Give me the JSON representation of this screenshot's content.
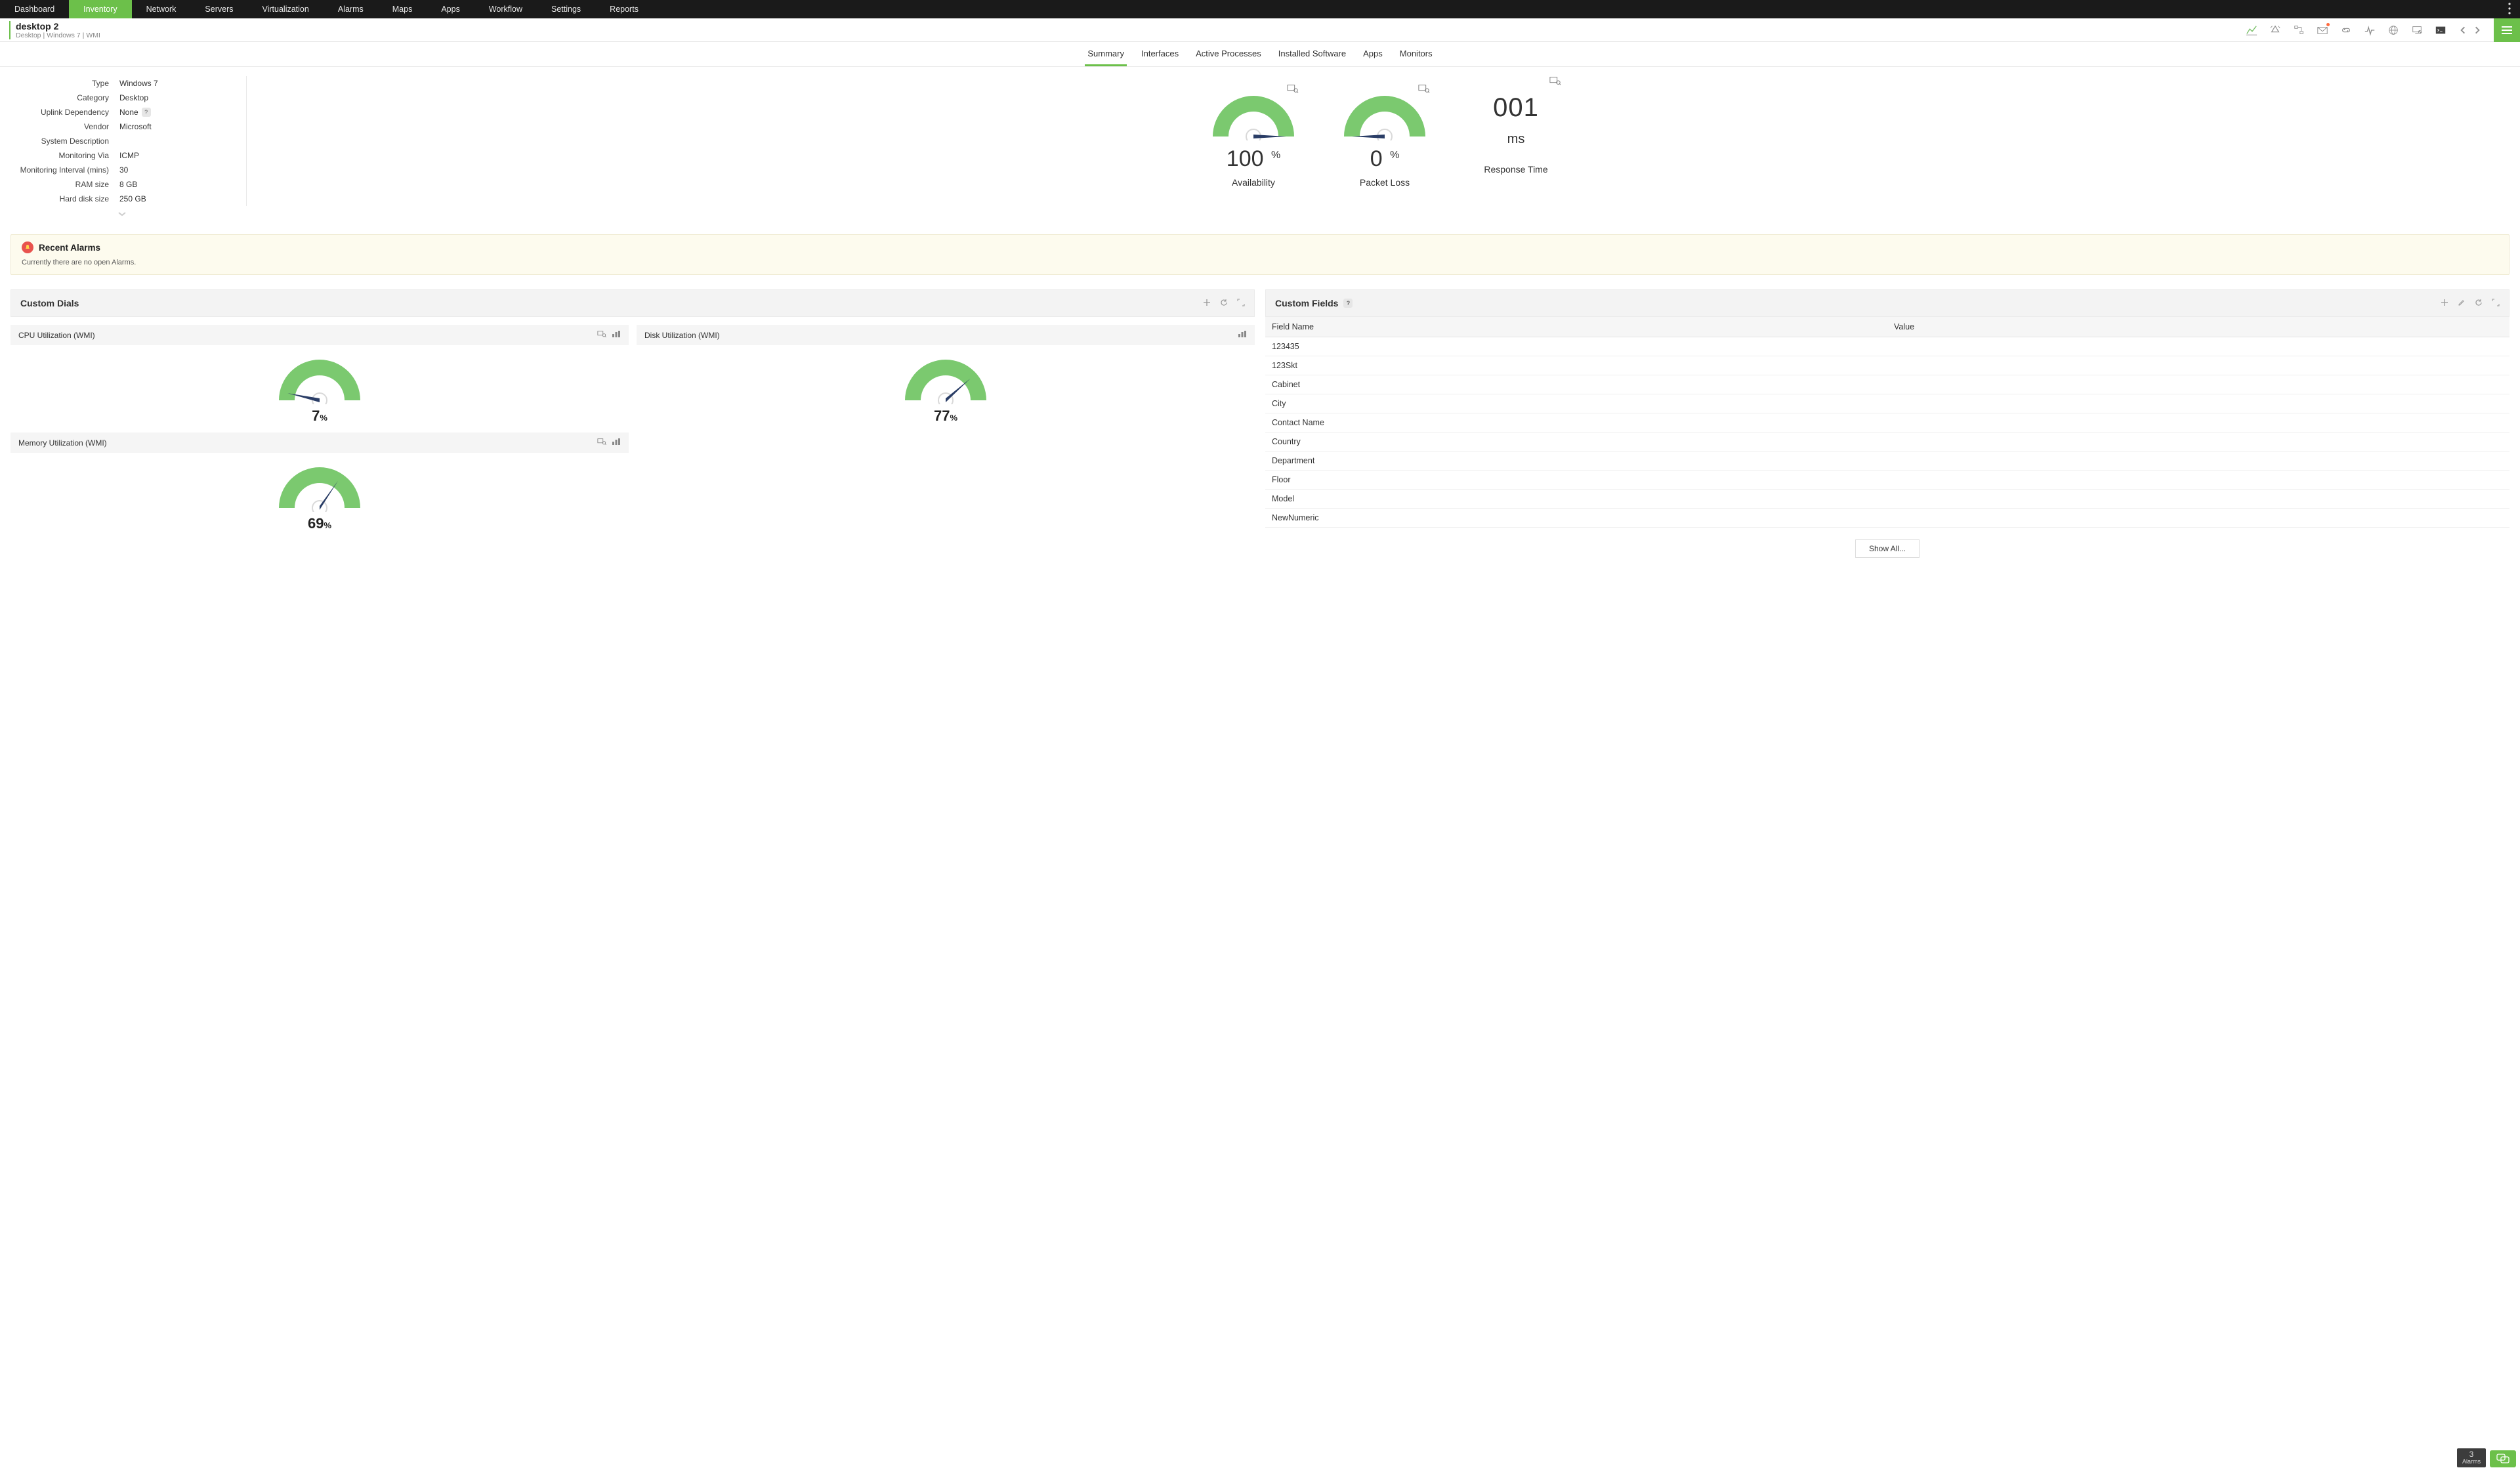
{
  "topnav": {
    "items": [
      "Dashboard",
      "Inventory",
      "Network",
      "Servers",
      "Virtualization",
      "Alarms",
      "Maps",
      "Apps",
      "Workflow",
      "Settings",
      "Reports"
    ],
    "active_index": 1
  },
  "subheader": {
    "title": "desktop 2",
    "crumbs": [
      "Desktop",
      "Windows 7",
      "WMI"
    ]
  },
  "tabs": {
    "items": [
      "Summary",
      "Interfaces",
      "Active Processes",
      "Installed Software",
      "Apps",
      "Monitors"
    ],
    "active_index": 0
  },
  "details": [
    {
      "label": "Type",
      "value": "Windows 7"
    },
    {
      "label": "Category",
      "value": "Desktop"
    },
    {
      "label": "Uplink Dependency",
      "value": "None",
      "help": true
    },
    {
      "label": "Vendor",
      "value": "Microsoft"
    },
    {
      "label": "System Description",
      "value": ""
    },
    {
      "label": "Monitoring Via",
      "value": "ICMP"
    },
    {
      "label": "Monitoring Interval (mins)",
      "value": "30"
    },
    {
      "label": "RAM size",
      "value": "8 GB"
    },
    {
      "label": "Hard disk size",
      "value": "250 GB"
    }
  ],
  "chart_data": {
    "kpi_gauges": [
      {
        "type": "gauge",
        "name": "Availability",
        "value": 100,
        "unit": "%",
        "min": 0,
        "max": 100
      },
      {
        "type": "gauge",
        "name": "Packet Loss",
        "value": 0,
        "unit": "%",
        "min": 0,
        "max": 100
      }
    ],
    "response_time": {
      "value": "001",
      "unit": "ms",
      "label": "Response Time"
    },
    "custom_dials": [
      {
        "type": "gauge",
        "name": "CPU Utilization (WMI)",
        "value": 7,
        "unit": "%",
        "min": 0,
        "max": 100
      },
      {
        "type": "gauge",
        "name": "Disk Utilization (WMI)",
        "value": 77,
        "unit": "%",
        "min": 0,
        "max": 100
      },
      {
        "type": "gauge",
        "name": "Memory Utilization (WMI)",
        "value": 69,
        "unit": "%",
        "min": 0,
        "max": 100
      }
    ]
  },
  "alarms": {
    "title": "Recent Alarms",
    "message": "Currently there are no open Alarms."
  },
  "panels": {
    "custom_dials_title": "Custom Dials",
    "custom_fields_title": "Custom Fields",
    "field_name_header": "Field Name",
    "value_header": "Value",
    "fields": [
      "123435",
      "123Skt",
      "Cabinet",
      "City",
      "Contact Name",
      "Country",
      "Department",
      "Floor",
      "Model",
      "NewNumeric"
    ],
    "show_all": "Show All..."
  },
  "footer": {
    "alarm_count": "3",
    "alarm_label": "Alarms"
  },
  "help_glyph": "?"
}
